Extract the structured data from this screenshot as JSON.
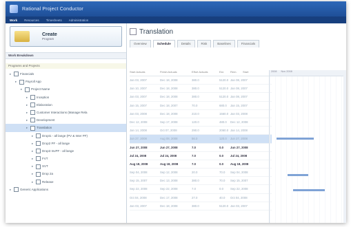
{
  "app": {
    "title": "Rational Project Conductor"
  },
  "menu": [
    {
      "label": "Work",
      "active": true
    },
    {
      "label": "Resources",
      "active": false
    },
    {
      "label": "Timesheets",
      "active": false
    },
    {
      "label": "Administration",
      "active": false
    }
  ],
  "create_panel": {
    "title": "Create",
    "subtitle": "Program"
  },
  "work_breakdown": {
    "heading": "Work Breakdown",
    "subhead": "Programs and Projects",
    "tree": [
      {
        "label": "Financials",
        "level": 0,
        "selected": false
      },
      {
        "label": "Payroll App",
        "level": 1,
        "selected": false
      },
      {
        "label": "Project Name",
        "level": 2,
        "selected": false
      },
      {
        "label": "Inception",
        "level": 3,
        "selected": false
      },
      {
        "label": "Elaboration",
        "level": 3,
        "selected": false
      },
      {
        "label": "Customer Interactions (Manage Rela",
        "level": 3,
        "selected": false
      },
      {
        "label": "Development",
        "level": 3,
        "selected": false
      },
      {
        "label": "Translation",
        "level": 3,
        "selected": true
      },
      {
        "label": "Dropt1 - all lange (PV & Inter PF)",
        "level": 4,
        "selected": false
      },
      {
        "label": "Drop2 PF - all lange",
        "level": 4,
        "selected": false
      },
      {
        "label": "Drop3 InvPF - all lange",
        "level": 4,
        "selected": false
      },
      {
        "label": "FVT",
        "level": 4,
        "selected": false
      },
      {
        "label": "SVT",
        "level": 4,
        "selected": false
      },
      {
        "label": "Drop 2a",
        "level": 4,
        "selected": false
      },
      {
        "label": "Release",
        "level": 4,
        "selected": false
      },
      {
        "label": "Generic Applications",
        "level": 0,
        "selected": false
      }
    ]
  },
  "page": {
    "title": "Translation",
    "tabs": [
      {
        "label": "Overview",
        "active": false
      },
      {
        "label": "Schedule",
        "active": true
      },
      {
        "label": "Details",
        "active": false
      },
      {
        "label": "Risk",
        "active": false
      },
      {
        "label": "Baselines",
        "active": false
      },
      {
        "label": "Financials",
        "active": false
      }
    ]
  },
  "schedule": {
    "columns": [
      "Start Actuals",
      "Finish Actuals",
      "Effort Actuals",
      "Est.",
      "Rem.",
      "Start"
    ],
    "rows": [
      {
        "cells": [
          "Jan 03, 2007",
          "Dec 18, 2008",
          "380.0",
          "5120.0",
          "Jan 08, 2007"
        ],
        "style": "light"
      },
      {
        "cells": [
          "Jan 10, 2007",
          "Dec 18, 2008",
          "380.0",
          "5120.0",
          "Jan 08, 2007"
        ],
        "style": "light"
      },
      {
        "cells": [
          "Jan 03, 2007",
          "Dec 18, 2008",
          "380.0",
          "5120.0",
          "Jan 08, 2007"
        ],
        "style": "light"
      },
      {
        "cells": [
          "Jan 15, 2007",
          "Dec 18, 2007",
          "70.0",
          "680.0",
          "Jan 15, 2007"
        ],
        "style": "light"
      },
      {
        "cells": [
          "Jan 03, 2008",
          "Dec 18, 2008",
          "210.0",
          "1560.0",
          "Jan 03, 2008"
        ],
        "style": "light"
      },
      {
        "cells": [
          "Dec 12, 2008",
          "Sep 17, 2008",
          "120.0",
          "480.0",
          "Dec 12, 2008"
        ],
        "style": "light"
      },
      {
        "cells": [
          "Jan 14, 2008",
          "Oct 07, 2008",
          "290.0",
          "2060.0",
          "Jan 14, 2008"
        ],
        "style": "light"
      },
      {
        "cells": [
          "Jun 27, 2008",
          "Aug 08, 2008",
          "56.0",
          "120.0",
          "Jun 27, 2008"
        ],
        "style": "sel"
      },
      {
        "cells": [
          "Jun 27, 2008",
          "Jun 27, 2008",
          "7.0",
          "0.0",
          "Jun 27, 2008"
        ],
        "style": "dark"
      },
      {
        "cells": [
          "Jul 24, 2008",
          "Jul 24, 2008",
          "7.0",
          "0.0",
          "Jul 24, 2008"
        ],
        "style": "dark"
      },
      {
        "cells": [
          "Aug 18, 2008",
          "Aug 18, 2008",
          "7.0",
          "0.0",
          "Aug 18, 2008"
        ],
        "style": "dark"
      },
      {
        "cells": [
          "Sep 04, 2008",
          "Sep 12, 2008",
          "20.0",
          "70.0",
          "Sep 04, 2008"
        ],
        "style": "light"
      },
      {
        "cells": [
          "Sep 15, 2007",
          "Dec 13, 2008",
          "380.0",
          "70.0",
          "Sep 15, 2007"
        ],
        "style": "light"
      },
      {
        "cells": [
          "Sep 22, 2008",
          "Sep 22, 2008",
          "7.0",
          "0.0",
          "Sep 22, 2008"
        ],
        "style": "light"
      },
      {
        "cells": [
          "Oct 04, 2008",
          "Dec 17, 2008",
          "27.0",
          "40.0",
          "Oct 04, 2008"
        ],
        "style": "light"
      },
      {
        "cells": [
          "Jan 03, 2007",
          "Dec 18, 2008",
          "380.0",
          "5120.0",
          "Jan 03, 2007"
        ],
        "style": "light"
      }
    ]
  },
  "gantt": {
    "headers": [
      "2008",
      "Nov 2008"
    ]
  }
}
